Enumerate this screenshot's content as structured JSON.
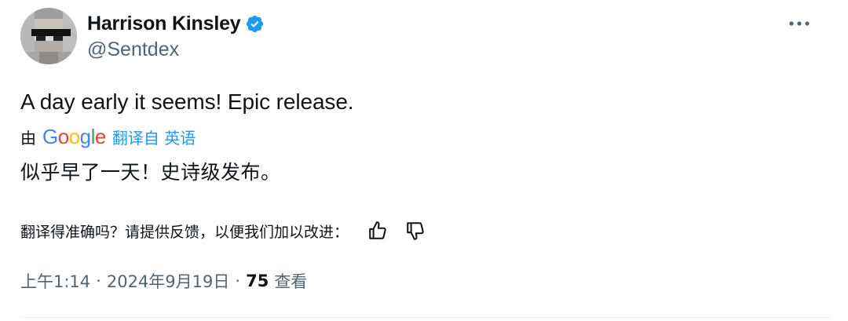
{
  "author": {
    "display_name": "Harrison Kinsley",
    "handle": "@Sentdex",
    "verified": true,
    "avatar_icon": "avatar"
  },
  "tweet": {
    "text": "A day early it seems! Epic release."
  },
  "translation": {
    "by_label": "由",
    "google_letters": [
      "G",
      "o",
      "o",
      "g",
      "l",
      "e"
    ],
    "translated_from": "翻译自 英语",
    "text": "似乎早了一天！史诗级发布。",
    "feedback_prompt": "翻译得准确吗？请提供反馈，以便我们加以改进：",
    "thumbs_up_icon": "thumbs-up-icon",
    "thumbs_down_icon": "thumbs-down-icon"
  },
  "meta": {
    "time": "上午1:14",
    "separator": "·",
    "date": "2024年9月19日",
    "views_count": "75",
    "views_label": "查看"
  },
  "colors": {
    "text_primary": "#0f1419",
    "text_secondary": "#536471",
    "accent": "#1d9bf0",
    "verified_badge": "#1d9bf0",
    "google_blue": "#4285f4",
    "google_red": "#ea4335",
    "google_yellow": "#fbbc05",
    "google_green": "#34a853"
  }
}
